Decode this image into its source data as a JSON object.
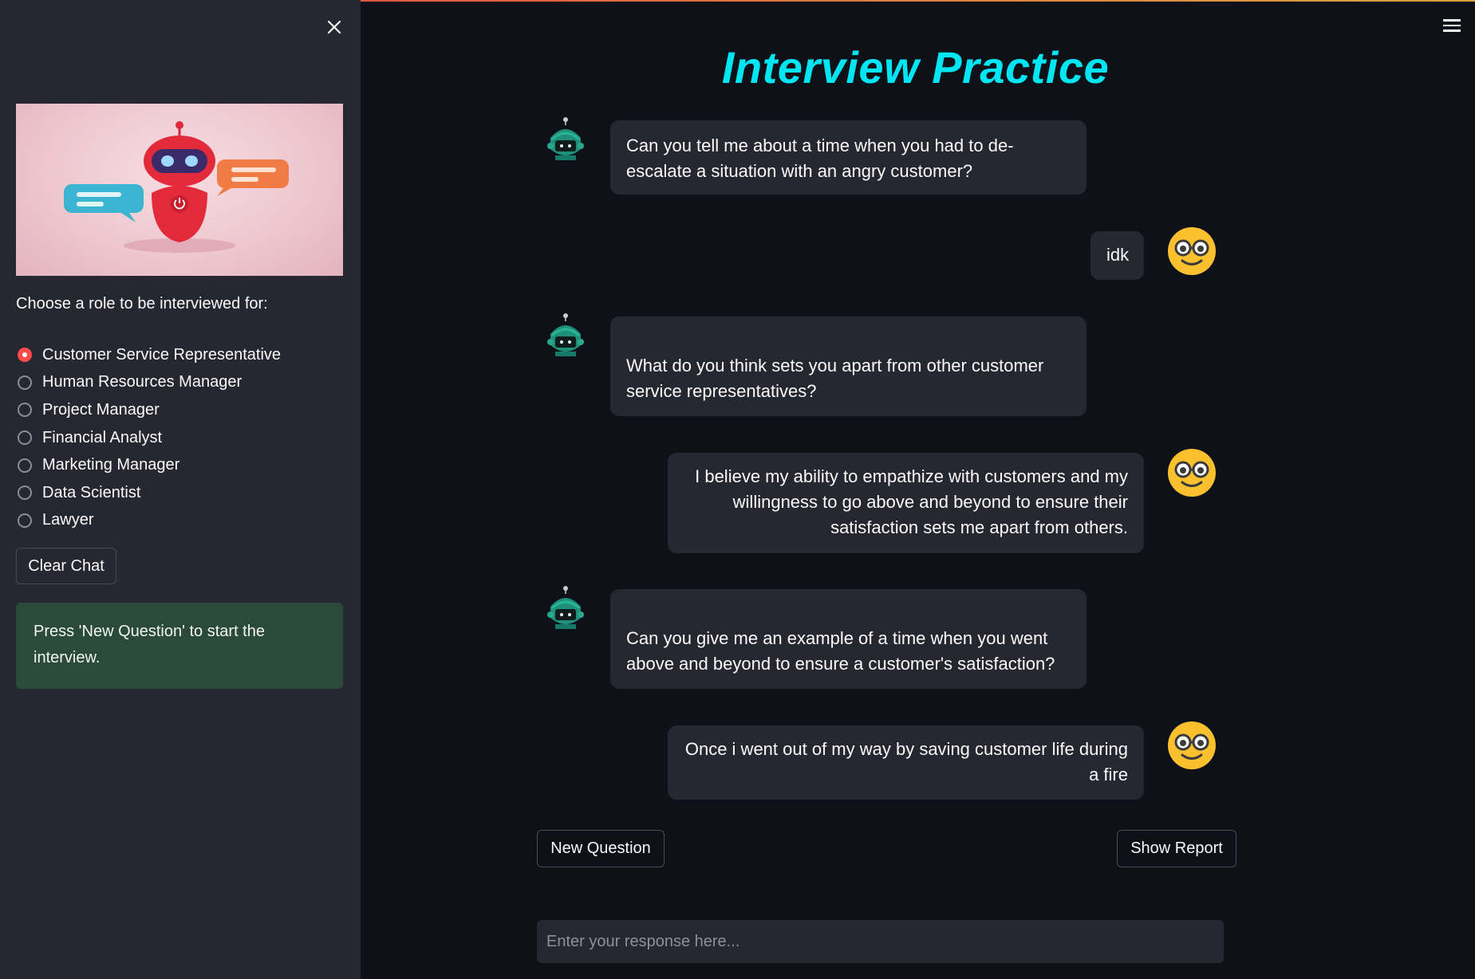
{
  "app": {
    "title": "Interview Practice"
  },
  "sidebar": {
    "close_icon": "close-icon",
    "hero_image": "chatbot-robot-with-speech-bubbles",
    "role_prompt": "Choose a role to be interviewed for:",
    "roles": [
      {
        "label": "Customer Service Representative",
        "selected": true
      },
      {
        "label": "Human Resources Manager",
        "selected": false
      },
      {
        "label": "Project Manager",
        "selected": false
      },
      {
        "label": "Financial Analyst",
        "selected": false
      },
      {
        "label": "Marketing Manager",
        "selected": false
      },
      {
        "label": "Data Scientist",
        "selected": false
      },
      {
        "label": "Lawyer",
        "selected": false
      }
    ],
    "clear_chat_label": "Clear Chat",
    "info_message": "Press 'New Question' to start the interview."
  },
  "header": {
    "menu_icon": "hamburger-menu-icon"
  },
  "chat": {
    "messages": [
      {
        "role": "assistant",
        "avatar": "robot-avatar-icon",
        "text": "Can you tell me about a time when you had to de-escalate a situation with an angry customer?"
      },
      {
        "role": "user",
        "avatar": "nerd-face-emoji-icon",
        "text": "idk"
      },
      {
        "role": "assistant",
        "avatar": "robot-avatar-icon",
        "text": "What do you think sets you apart from other customer service representatives?"
      },
      {
        "role": "user",
        "avatar": "nerd-face-emoji-icon",
        "text": "I believe my ability to empathize with customers and my willingness to go above and beyond to ensure their satisfaction sets me apart from others."
      },
      {
        "role": "assistant",
        "avatar": "robot-avatar-icon",
        "text": "Can you give me an example of a time when you went above and beyond to ensure a customer's satisfaction?"
      },
      {
        "role": "user",
        "avatar": "nerd-face-emoji-icon",
        "text": "Once i went out of my way by saving customer life during a fire"
      }
    ]
  },
  "actions": {
    "new_question_label": "New Question",
    "show_report_label": "Show Report"
  },
  "input": {
    "placeholder": "Enter your response here...",
    "value": ""
  },
  "colors": {
    "background": "#0e1117",
    "sidebar": "#262730",
    "bubble": "#262730",
    "title": "#00e5f2",
    "radio_selected": "#ff4b4b",
    "info_box": "#2b4a3a"
  }
}
